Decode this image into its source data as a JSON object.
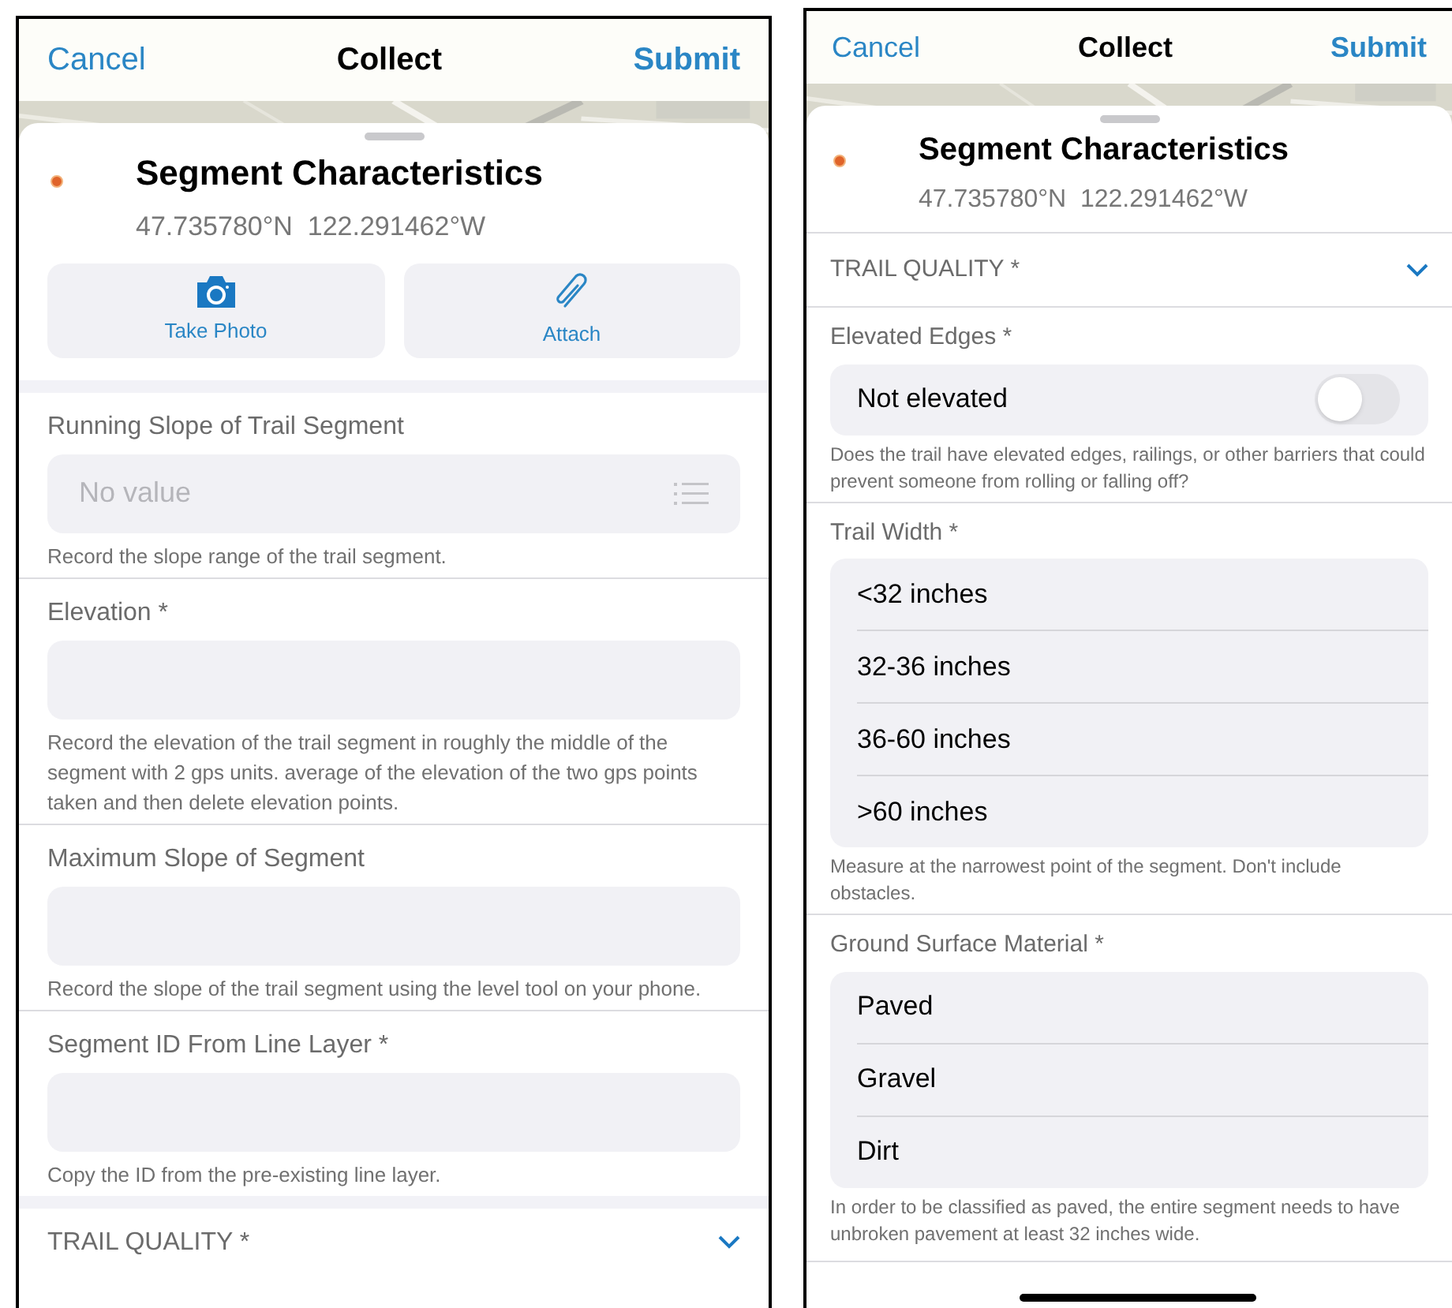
{
  "screens": [
    {
      "nav": {
        "cancel": "Cancel",
        "title": "Collect",
        "submit": "Submit"
      },
      "header": {
        "title": "Segment Characteristics",
        "coords": "47.735780°N  122.291462°W"
      },
      "actions": [
        {
          "kind": "camera",
          "label": "Take Photo"
        },
        {
          "kind": "clip",
          "label": "Attach"
        }
      ],
      "sections": [
        {
          "kind": "field",
          "label": "Running Slope of Trail Segment",
          "field": {
            "kind": "select",
            "placeholder": "No value"
          },
          "hint": "Record the slope range of the trail segment."
        },
        {
          "kind": "field",
          "label": "Elevation *",
          "field": {
            "kind": "text"
          },
          "hint": "Record the elevation of the trail segment in roughly the middle of the segment with 2 gps units. average of the elevation of the two gps points taken and then delete elevation points."
        },
        {
          "kind": "field",
          "label": "Maximum Slope of Segment",
          "field": {
            "kind": "text"
          },
          "hint": "Record the slope of the trail segment using the level tool on your phone."
        },
        {
          "kind": "field",
          "label": "Segment ID From Line Layer *",
          "field": {
            "kind": "text"
          },
          "hint": "Copy the ID from the pre-existing line layer."
        },
        {
          "kind": "group",
          "label": "TRAIL QUALITY *"
        }
      ]
    },
    {
      "nav": {
        "cancel": "Cancel",
        "title": "Collect",
        "submit": "Submit"
      },
      "header": {
        "title": "Segment Characteristics",
        "coords": "47.735780°N  122.291462°W"
      },
      "sections": [
        {
          "kind": "group",
          "label": "TRAIL QUALITY *"
        },
        {
          "kind": "field",
          "label": "Elevated Edges *",
          "field": {
            "kind": "toggle",
            "value": "Not elevated",
            "on": false
          },
          "hint": "Does the trail have elevated edges, railings, or other barriers that could prevent someone from rolling or falling off?"
        },
        {
          "kind": "field",
          "label": "Trail Width *",
          "field": {
            "kind": "options",
            "options": [
              "<32 inches",
              "32-36 inches",
              "36-60 inches",
              ">60 inches"
            ]
          },
          "hint": "Measure at the narrowest point of the segment. Don't include obstacles."
        },
        {
          "kind": "field",
          "label": "Ground Surface Material *",
          "field": {
            "kind": "options",
            "options": [
              "Paved",
              "Gravel",
              "Dirt"
            ]
          },
          "hint": "In order to be classified as paved, the entire segment needs to have unbroken pavement at least 32 inches wide."
        }
      ]
    }
  ]
}
